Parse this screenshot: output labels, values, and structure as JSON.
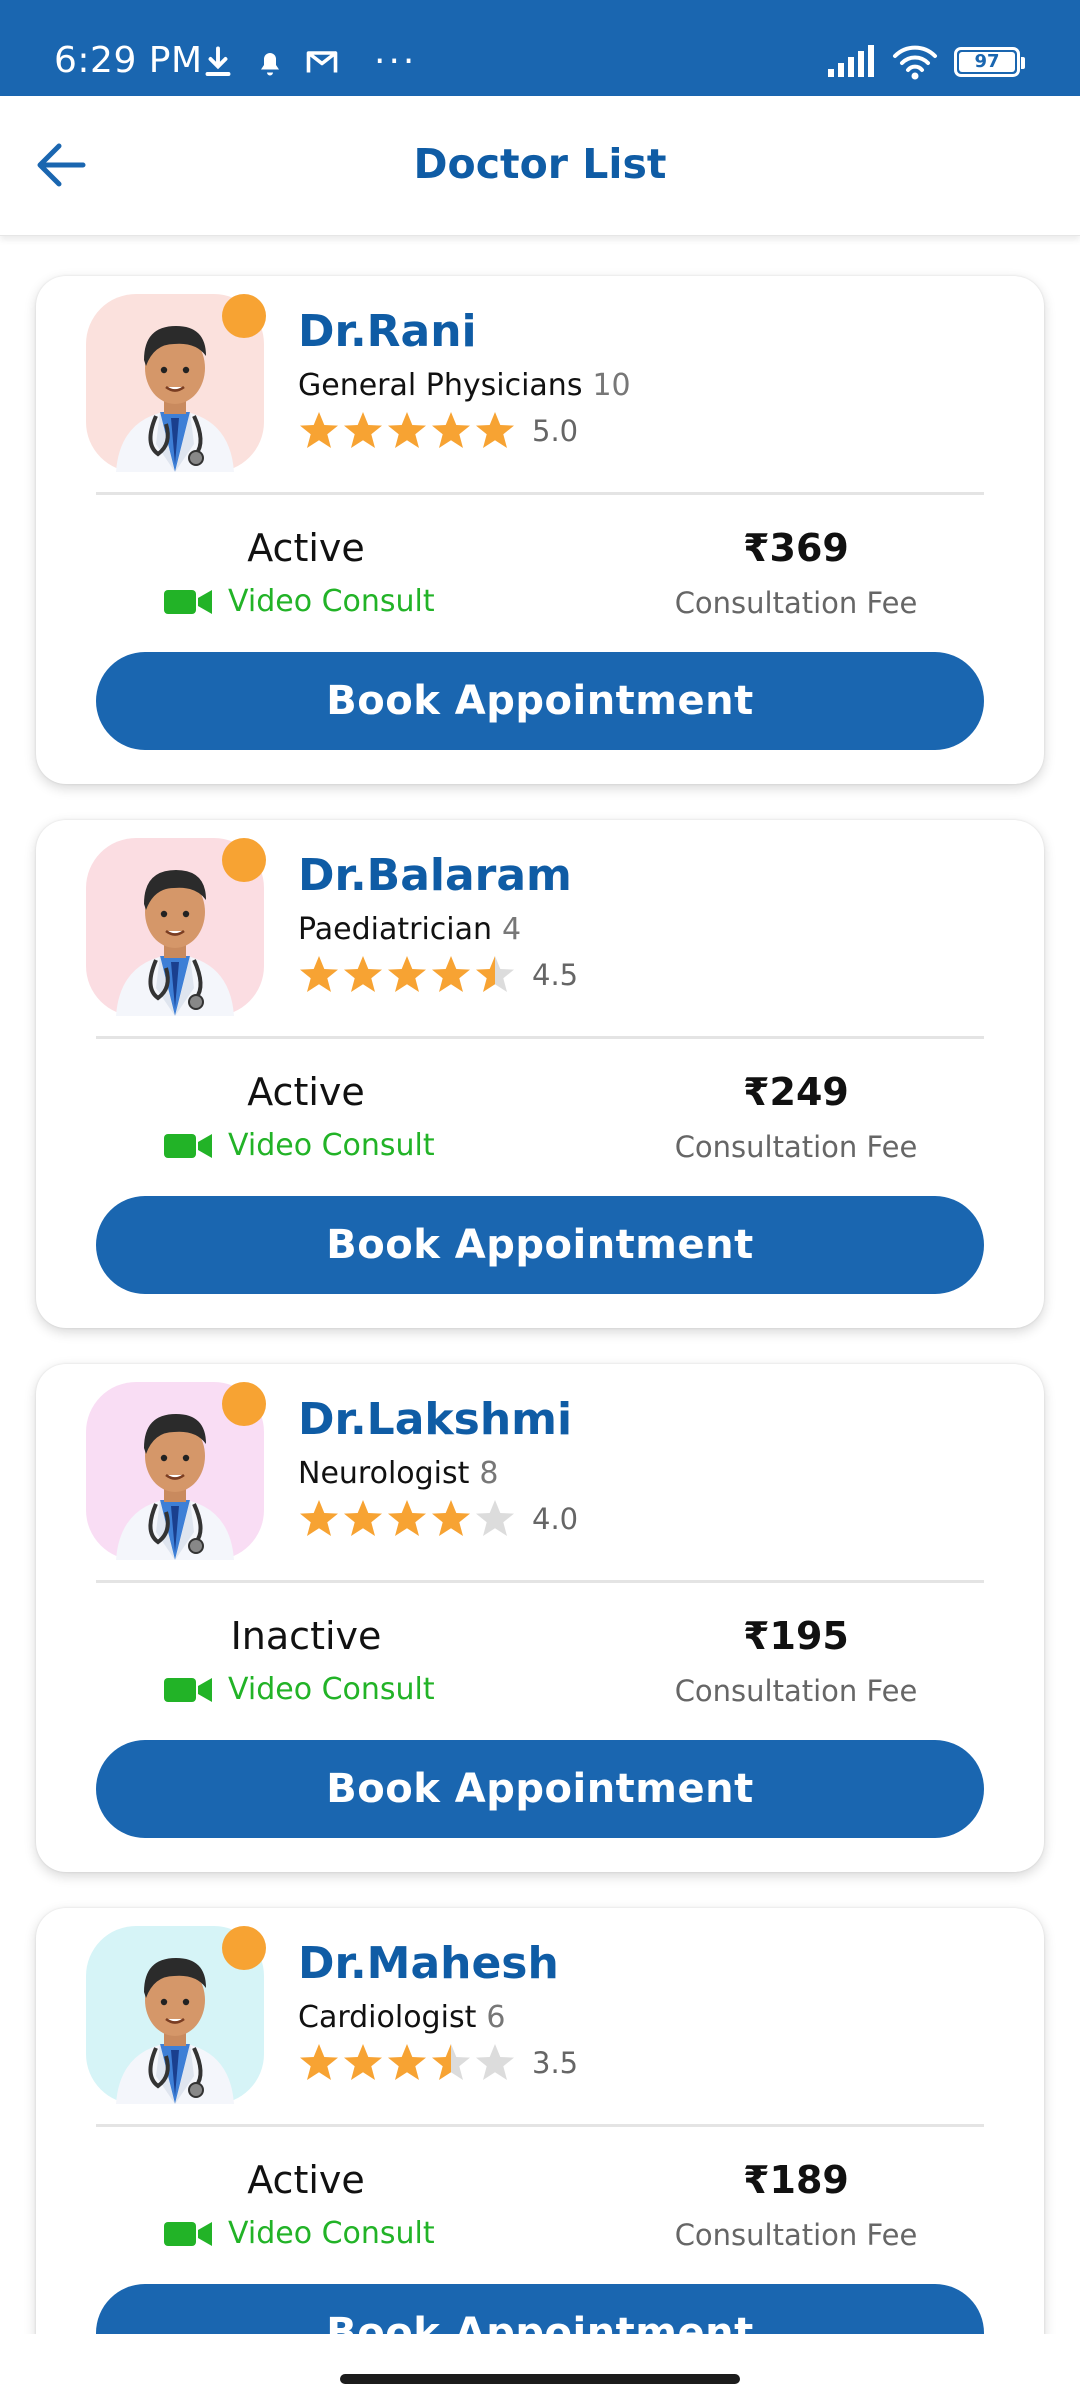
{
  "status_bar": {
    "time": "6:29 PM",
    "icons_left": [
      "download-icon",
      "notification-bell-icon",
      "gmail-icon",
      "more-dots-icon"
    ],
    "dots": "···",
    "icons_right": [
      "signal-icon",
      "wifi-icon",
      "battery-icon"
    ],
    "battery": "97"
  },
  "app_bar": {
    "back_icon": "arrow-left-icon",
    "title": "Doctor List"
  },
  "colors": {
    "primary": "#1a66b0",
    "title_blue": "#0f5ca5",
    "star": "#f7a333",
    "star_empty": "#dcdcdc",
    "video_green": "#22b327",
    "online_dot": "#f7a333"
  },
  "doctors": [
    {
      "name": "Dr.Rani",
      "specialty": "General Physicians",
      "experience": "10",
      "rating": 5.0,
      "rating_text": "5.0",
      "status": "Active",
      "consult_type": "Video Consult",
      "fee": "₹369",
      "fee_label": "Consultation Fee",
      "button": "Book Appointment",
      "avatar_bg": "#fbe1dd"
    },
    {
      "name": "Dr.Balaram",
      "specialty": "Paediatrician",
      "experience": "4",
      "rating": 4.5,
      "rating_text": "4.5",
      "status": "Active",
      "consult_type": "Video Consult",
      "fee": "₹249",
      "fee_label": "Consultation Fee",
      "button": "Book Appointment",
      "avatar_bg": "#fbdde2"
    },
    {
      "name": "Dr.Lakshmi",
      "specialty": "Neurologist",
      "experience": "8",
      "rating": 4.0,
      "rating_text": "4.0",
      "status": "Inactive",
      "consult_type": "Video Consult",
      "fee": "₹195",
      "fee_label": "Consultation Fee",
      "button": "Book Appointment",
      "avatar_bg": "#f9ddf4"
    },
    {
      "name": "Dr.Mahesh",
      "specialty": "Cardiologist",
      "experience": "6",
      "rating": 3.5,
      "rating_text": "3.5",
      "status": "Active",
      "consult_type": "Video Consult",
      "fee": "₹189",
      "fee_label": "Consultation Fee",
      "button": "Book Appointment",
      "avatar_bg": "#d6f4f7"
    }
  ]
}
